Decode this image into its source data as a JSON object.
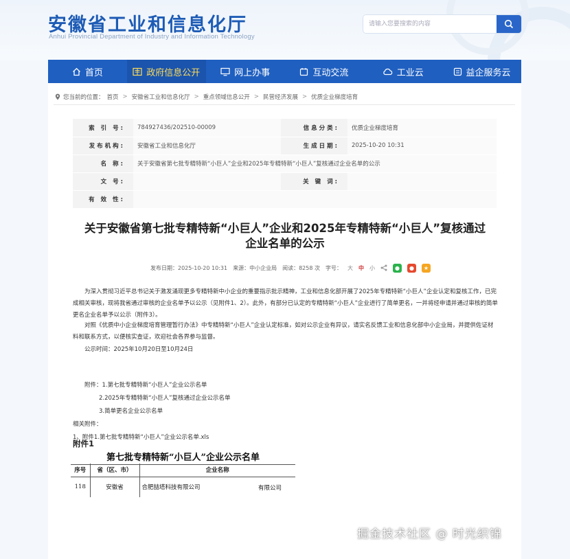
{
  "header": {
    "title": "安徽省工业和信息化厅",
    "subtitle": "Anhui Provincial Department of Industry and Information Technology",
    "search_placeholder": "请输入您要搜索的内容"
  },
  "nav": [
    {
      "label": "首页",
      "icon": "home-icon"
    },
    {
      "label": "政府信息公开",
      "icon": "document-icon"
    },
    {
      "label": "网上办事",
      "icon": "monitor-icon"
    },
    {
      "label": "互动交流",
      "icon": "chat-icon"
    },
    {
      "label": "工业云",
      "icon": "cloud-icon"
    },
    {
      "label": "益企服务云",
      "icon": "service-icon"
    }
  ],
  "breadcrumb": {
    "prefix": "您当前的位置：",
    "items": [
      "首页",
      "安徽省工业和信息化厅",
      "重点领域信息公开",
      "民营经济发展",
      "优质企业梯度培育"
    ]
  },
  "meta": {
    "index_label": "索 引 号:",
    "index_value": "784927436/202510-00009",
    "category_label": "信息分类:",
    "category_value": "优质企业梯度培育",
    "publisher_label": "发布机构:",
    "publisher_value": "安徽省工业和信息化厅",
    "date_label": "生成日期:",
    "date_value": "2025-10-20 10:31",
    "name_label": "名    称:",
    "name_value": "关于安徽省第七批专精特新“小巨人”企业和2025年专精特新“小巨人”复核通过企业名单的公示",
    "docno_label": "文    号:",
    "docno_value": "",
    "keyword_label": "关 键 词:",
    "keyword_value": "",
    "validity_label": "有 效 性:",
    "validity_value": ""
  },
  "article": {
    "title_line1": "关于安徽省第七批专精特新“小巨人”企业和2025年专精特新“小巨人”复核通过",
    "title_line2": "企业名单的公示",
    "pub_date": "发布日期：2025-10-20 10:31",
    "source": "来源：中小企业局",
    "views": "阅读：8258 次",
    "font_label": "字号：",
    "size_large": "大",
    "size_mid": "中",
    "size_small": "小",
    "para1": "为深入贯彻习近平总书记关于激发涌现更多专精特新中小企业的重要指示批示精神，工业和信息化部开展了2025年专精特新“小巨人”企业认定和复核工作，已完成相关审核，现将我省通过审核的企业名单予以公示（见附件1、2）。此外，有部分已认定的专精特新“小巨人”企业进行了简单更名，一并将经申请并通过审核的简单更名企业名单予以公示（附件3）。",
    "para2": "对照《优质中小企业梯度培育管理暂行办法》中专精特新“小巨人”企业认定标准，如对公示企业有异议，请实名反馈工业和信息化部中小企业局，并提供佐证材料和联系方式，以便核实查证，欢迎社会各界参与监督。",
    "para3": "公示时间：2025年10月20日至10月24日",
    "att1": "附件：1.第七批专精特新“小巨人”企业公示名单",
    "att2": "2.2025年专精特新“小巨人”复核通过企业公示名单",
    "att3": "3.简单更名企业公示名单",
    "related": "相关附件：",
    "related_file": "1、附件1.第七批专精特新“小巨人”企业公示名单.xls"
  },
  "attachment": {
    "heading": "附件1",
    "table_title": "第七批专精特新“小巨人”企业公示名单",
    "columns": [
      "序号",
      "省（区、市）",
      "企业名称"
    ],
    "rows": [
      [
        "118",
        "安徽省",
        "合肥喆塔科技有限公司"
      ]
    ],
    "extra": "有限公司"
  },
  "watermark": "掘金技术社区 @ 时光织锦",
  "colors": {
    "brand": "#1d5bb5",
    "nav": "#1f5fc0",
    "nav_active_text": "#ffdc5a"
  }
}
